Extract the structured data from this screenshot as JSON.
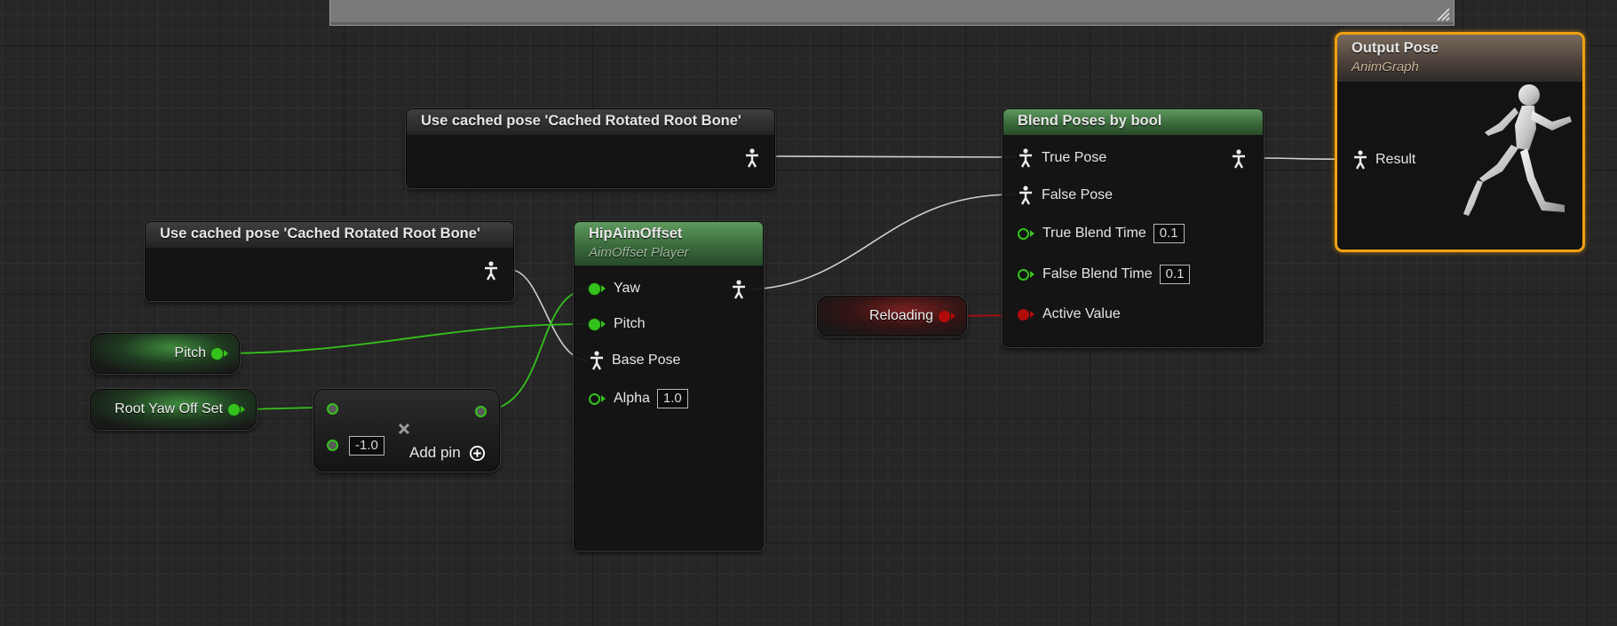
{
  "graph": {
    "cached_pose_node_1": {
      "title": "Use cached pose 'Cached Rotated Root Bone'"
    },
    "cached_pose_node_2": {
      "title": "Use cached pose 'Cached Rotated Root Bone'"
    },
    "aim_offset_node": {
      "title": "HipAimOffset",
      "subtitle": "AimOffset Player",
      "pins": {
        "yaw": "Yaw",
        "pitch": "Pitch",
        "base_pose": "Base Pose",
        "alpha": "Alpha"
      },
      "alpha_value": "1.0"
    },
    "blend_node": {
      "title": "Blend Poses by bool",
      "pins": {
        "true_pose": "True Pose",
        "false_pose": "False Pose",
        "true_blend_time": "True Blend Time",
        "false_blend_time": "False Blend Time",
        "active_value": "Active Value"
      },
      "true_blend_time_value": "0.1",
      "false_blend_time_value": "0.1"
    },
    "output_pose_node": {
      "title": "Output Pose",
      "subtitle": "AnimGraph",
      "result_label": "Result"
    },
    "pitch_var": {
      "label": "Pitch"
    },
    "root_yaw_var": {
      "label": "Root Yaw Off Set"
    },
    "reloading_var": {
      "label": "Reloading"
    },
    "multiply_node": {
      "operand_value": "-1.0",
      "add_pin_label": "Add pin"
    }
  },
  "colors": {
    "float_pin": "#35c21c",
    "bool_pin": "#b00b0b",
    "exec_wire": "#d8d8d8",
    "selected_outline": "#f0a010"
  },
  "icons": {
    "pose_pin": "pose-figure-icon",
    "multiply": "multiply-icon",
    "add_pin": "add-circle-icon",
    "mannequin": "mannequin-icon",
    "resize": "resize-grip-icon"
  }
}
